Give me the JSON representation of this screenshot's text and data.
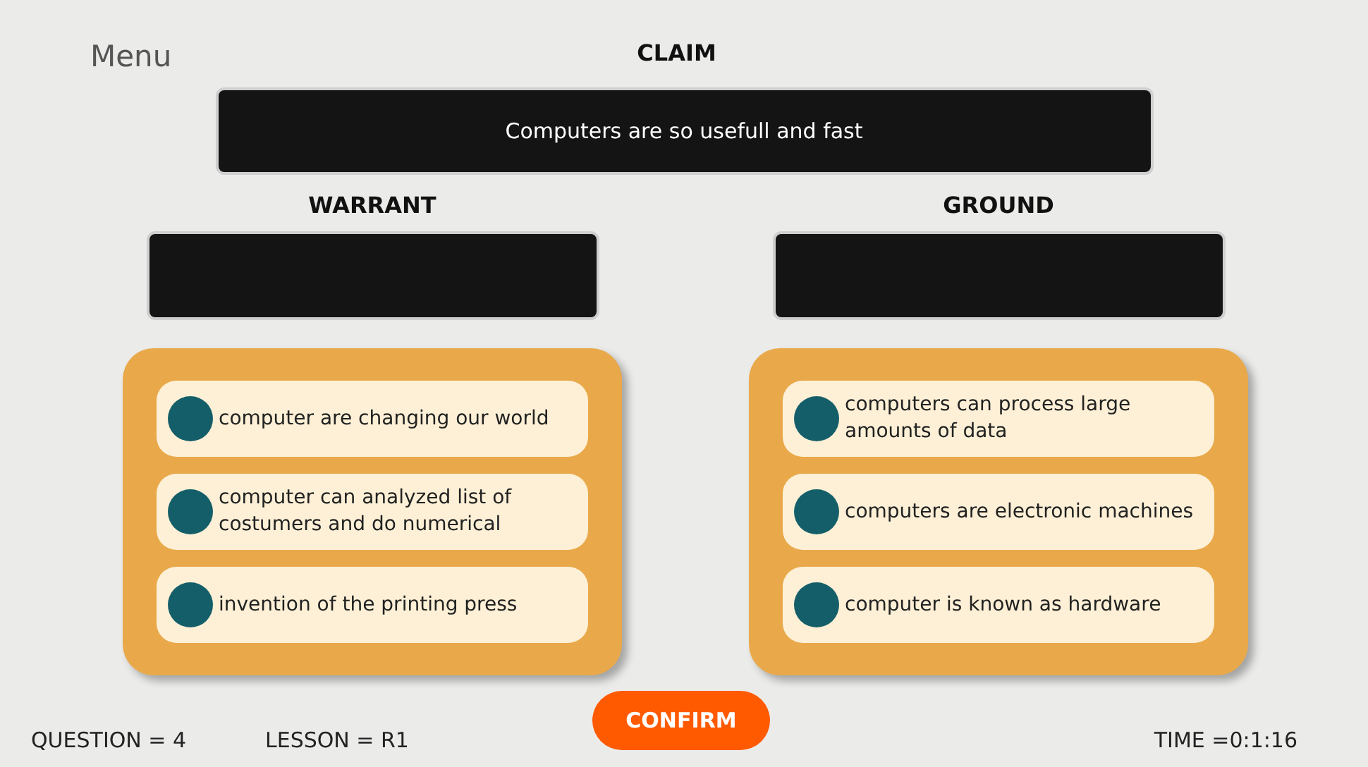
{
  "menu": "Menu",
  "claim": {
    "heading": "CLAIM",
    "text": "Computers are so usefull and fast"
  },
  "columns": [
    {
      "heading": "WARRANT",
      "options": [
        {
          "text": "computer are changing our world"
        },
        {
          "text": "computer can analyzed list of costumers and do numerical"
        },
        {
          "text": "invention of the printing press"
        }
      ]
    },
    {
      "heading": "GROUND",
      "options": [
        {
          "text": "computers can process large amounts of data"
        },
        {
          "text": "computers are electronic machines"
        },
        {
          "text": "computer is known as hardware"
        }
      ]
    }
  ],
  "confirm_button": "CONFIRM",
  "status": {
    "question": "QUESTION = 4",
    "lesson": "LESSON = R1",
    "time": "TIME =0:1:16"
  }
}
